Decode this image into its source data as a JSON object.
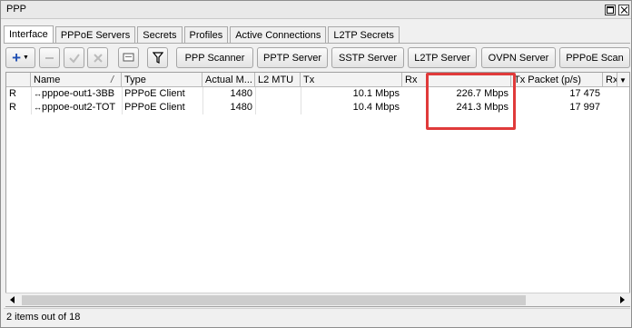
{
  "window": {
    "title": "PPP"
  },
  "tabs": [
    "Interface",
    "PPPoE Servers",
    "Secrets",
    "Profiles",
    "Active Connections",
    "L2TP Secrets"
  ],
  "toolbar": {
    "add_label": "+",
    "buttons": [
      "PPP Scanner",
      "PPTP Server",
      "SSTP Server",
      "L2TP Server",
      "OVPN Server",
      "PPPoE Scan"
    ]
  },
  "table": {
    "columns": [
      "Name",
      "Type",
      "Actual M...",
      "L2 MTU",
      "Tx",
      "Rx",
      "Tx Packet (p/s)",
      "Rx"
    ],
    "sort_indicator": "/",
    "rows": [
      {
        "flag": "R",
        "name": "pppoe-out1-3BB",
        "type": "PPPoE Client",
        "mtu": "1480",
        "l2mtu": "",
        "tx": "10.1 Mbps",
        "rx": "226.7 Mbps",
        "txp": "17 475"
      },
      {
        "flag": "R",
        "name": "pppoe-out2-TOT",
        "type": "PPPoE Client",
        "mtu": "1480",
        "l2mtu": "",
        "tx": "10.4 Mbps",
        "rx": "241.3 Mbps",
        "txp": "17 997"
      }
    ]
  },
  "status": {
    "text": "2 items out of 18"
  },
  "colors": {
    "highlight": "#e03a3a",
    "add_icon": "#1f4fb3"
  }
}
